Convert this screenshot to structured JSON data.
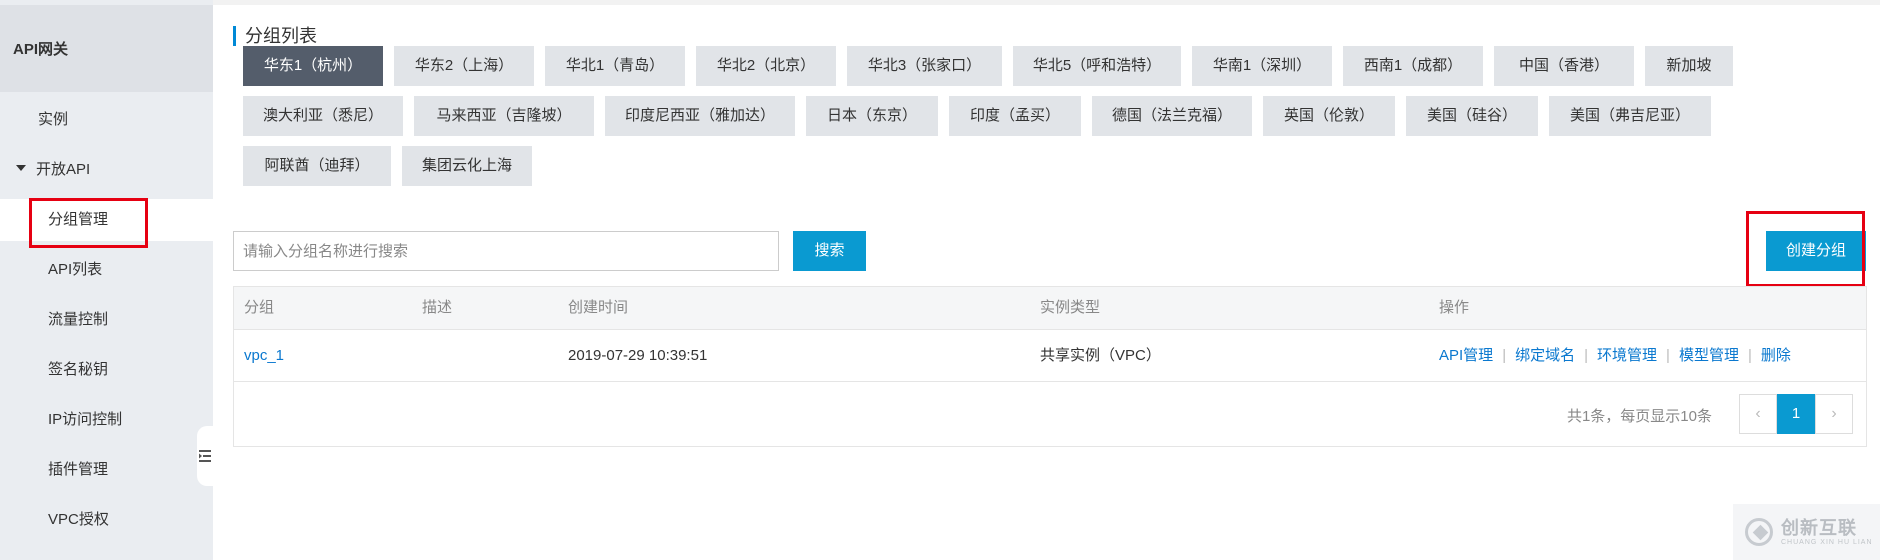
{
  "sidebar": {
    "title": "API网关",
    "items": [
      {
        "label": "实例"
      },
      {
        "label": "开放API"
      },
      {
        "label": "分组管理"
      },
      {
        "label": "API列表"
      },
      {
        "label": "流量控制"
      },
      {
        "label": "签名秘钥"
      },
      {
        "label": "IP访问控制"
      },
      {
        "label": "插件管理"
      },
      {
        "label": "VPC授权"
      }
    ]
  },
  "main": {
    "section_title": "分组列表",
    "regions": [
      "华东1（杭州）",
      "华东2（上海）",
      "华北1（青岛）",
      "华北2（北京）",
      "华北3（张家口）",
      "华北5（呼和浩特）",
      "华南1（深圳）",
      "西南1（成都）",
      "中国（香港）",
      "新加坡",
      "澳大利亚（悉尼）",
      "马来西亚（吉隆坡）",
      "印度尼西亚（雅加达）",
      "日本（东京）",
      "印度（孟买）",
      "德国（法兰克福）",
      "英国（伦敦）",
      "美国（硅谷）",
      "美国（弗吉尼亚）",
      "阿联酋（迪拜）",
      "集团云化上海"
    ],
    "active_region": "华东1（杭州）",
    "search": {
      "placeholder": "请输入分组名称进行搜索",
      "button": "搜索"
    },
    "create_button": "创建分组",
    "table": {
      "headers": [
        "分组",
        "描述",
        "创建时间",
        "实例类型",
        "操作"
      ],
      "rows": [
        {
          "group": "vpc_1",
          "description": "",
          "created": "2019-07-29 10:39:51",
          "instance_type": "共享实例（VPC）",
          "ops": [
            "API管理",
            "绑定域名",
            "环境管理",
            "模型管理",
            "删除"
          ]
        }
      ]
    },
    "pagination": {
      "summary": "共1条，每页显示10条",
      "prev": "‹",
      "current": "1",
      "next": "›"
    }
  },
  "watermark": {
    "cn": "创新互联",
    "en": "CHUANG XIN HU LIAN"
  },
  "colors": {
    "accent": "#0a9ad1",
    "active_region": "#545d6b",
    "highlight": "#e60012",
    "top_accent": "#f39800"
  },
  "icons": {
    "collapse": "collapse-sidebar-icon",
    "caret": "caret-down-icon"
  }
}
